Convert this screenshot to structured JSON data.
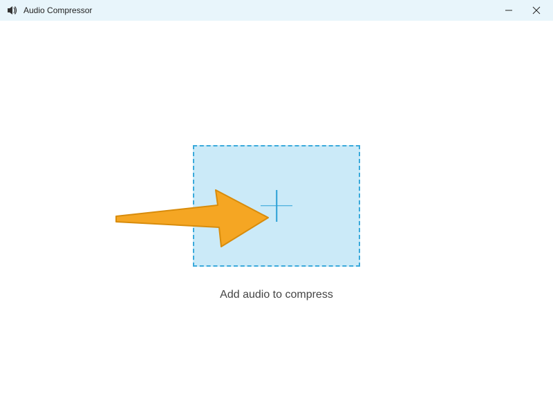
{
  "titlebar": {
    "app_title": "Audio Compressor"
  },
  "main": {
    "instruction": "Add audio to compress"
  },
  "colors": {
    "titlebar_bg": "#e8f5fb",
    "dropzone_bg": "#cbeaf8",
    "dropzone_border": "#39a9db",
    "plus_color": "#2a9fd6",
    "arrow_fill": "#f5a623",
    "arrow_stroke": "#d88c0c"
  }
}
